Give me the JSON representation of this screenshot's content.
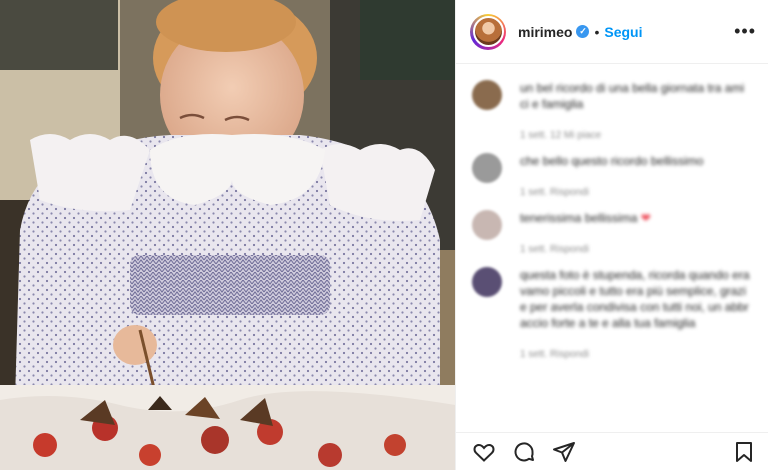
{
  "header": {
    "username": "mirimeo",
    "separator": "•",
    "follow_label": "Segui",
    "more_label": "•••"
  },
  "comments": [
    {
      "text": "un bel ricordo di una bella giornata tra amici e famiglia",
      "meta": "1 sett. 12 Mi piace",
      "avatar_color": "#8a6b4e"
    },
    {
      "text": "che bello questo ricordo bellissimo",
      "meta": "1 sett. Rispondi",
      "avatar_color": "#9a9a9a"
    },
    {
      "text": "tenerissima bellissima",
      "heart": "❤",
      "meta": "1 sett. Rispondi",
      "avatar_color": "#c8b7b2"
    },
    {
      "text": "questa foto è stupenda, ricorda quando eravamo piccoli e tutto era più semplice, grazie per averla condivisa con tutti noi, un abbraccio forte a te e alla tua famiglia",
      "meta": "1 sett. Rispondi",
      "avatar_color": "#5a4f74"
    }
  ],
  "icons": {
    "like": "heart-icon",
    "comment": "comment-icon",
    "share": "share-icon",
    "save": "bookmark-icon"
  },
  "colors": {
    "link_blue": "#0095f6",
    "verified_blue": "#3897f0",
    "heart_red": "#ed4956"
  }
}
